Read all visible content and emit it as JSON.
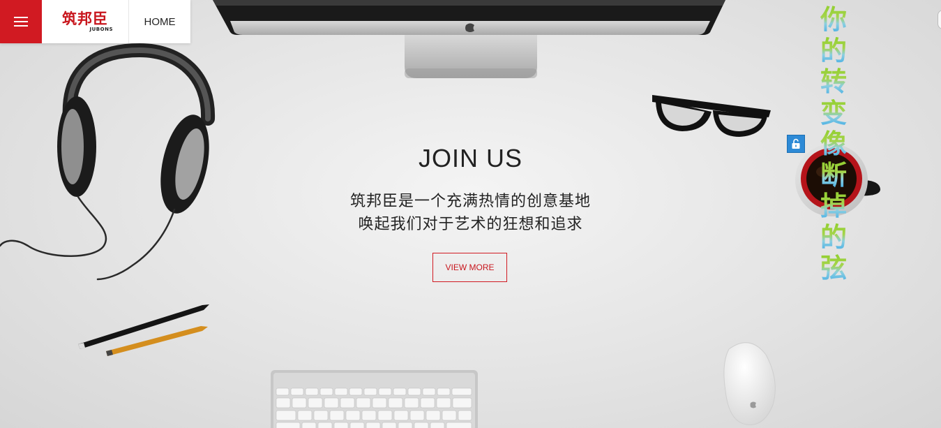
{
  "nav": {
    "menu_icon": "hamburger-icon",
    "logo_text": "筑邦臣",
    "logo_subtext": "JUBONS",
    "home_label": "HOME"
  },
  "hero": {
    "title": "JOIN US",
    "line1": "筑邦臣是一个充满热情的创意基地",
    "line2": "唤起我们对于艺术的狂想和追求",
    "button_label": "VIEW MORE"
  },
  "lyric": {
    "chars": [
      "你",
      "的",
      "转",
      "变",
      "像",
      "断",
      "掉",
      "的",
      "弦"
    ]
  },
  "colors": {
    "brand_red": "#d11a22",
    "lyric_green": "#8fce2c",
    "lyric_blue": "#39a7e6",
    "lock_blue": "#2d8ad6"
  },
  "decor": [
    "monitor-image",
    "headphones-image",
    "glasses-image",
    "coffee-cup-image",
    "pencils-image",
    "keyboard-image",
    "mouse-image"
  ]
}
